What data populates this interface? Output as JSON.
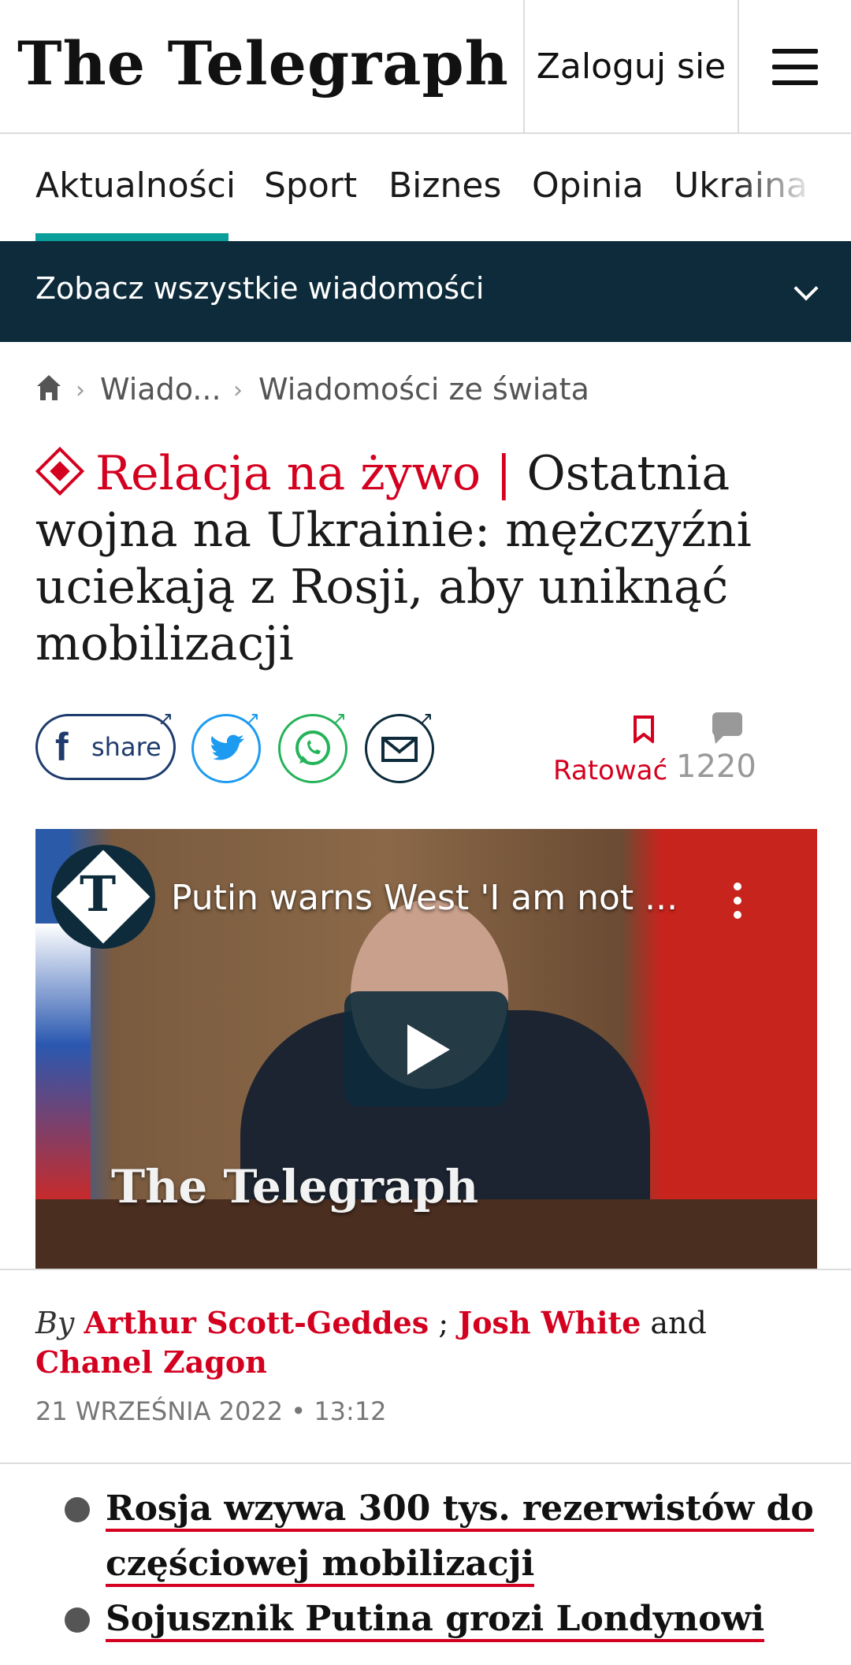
{
  "header": {
    "logo": "The Telegraph",
    "login_label": "Zaloguj sie"
  },
  "nav": {
    "items": [
      "Aktualności",
      "Sport",
      "Biznes",
      "Opinia",
      "Ukraina"
    ],
    "active": "Aktualności"
  },
  "banner": {
    "label": "Zobacz wszystkie wiadomości"
  },
  "breadcrumb": {
    "items": [
      "Wiado...",
      "Wiadomości ze świata"
    ]
  },
  "article": {
    "live_label": "Relacja na żywo",
    "separator": "|",
    "title": "Ostatnia wojna na Ukrainie: mężczyźni uciekają z Rosji, aby uniknąć mobilizacji",
    "share_label": "share",
    "save_label": "Ratować",
    "comment_count": "1220",
    "video": {
      "title": "Putin warns West 'I am not ...",
      "watermark": "The Telegraph",
      "channel_logo_letter": "T"
    },
    "byline": {
      "prefix": "By",
      "authors": [
        "Arthur Scott-Geddes",
        "Josh White",
        "Chanel Zagon"
      ],
      "sep1": ";",
      "sep2": "and"
    },
    "date": "21 WRZEŚNIA 2022 • 13:12",
    "bullets": [
      "Rosja wzywa 300 tys. rezerwistów do częściowej mobilizacji",
      "Sojusznik Putina grozi Londynowi"
    ]
  },
  "colors": {
    "accent_red": "#d4001f",
    "nav_active": "#0a9e9a",
    "banner_bg": "#0d2b3b"
  }
}
